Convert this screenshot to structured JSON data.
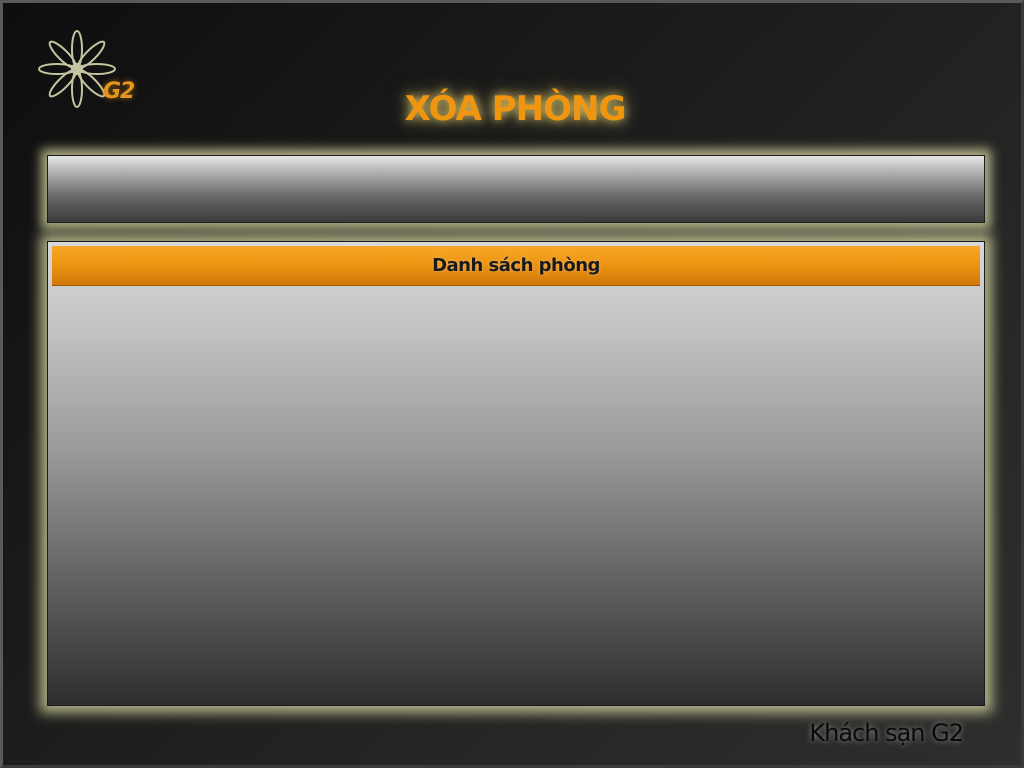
{
  "app": {
    "logo_text": "G2",
    "title": "XÓA PHÒNG",
    "footer": "Khách sạn G2"
  },
  "list": {
    "header": "Danh sách phòng",
    "items": []
  },
  "colors": {
    "accent": "#f0950f",
    "header_bar": "#ee9512",
    "glow": "#e1e1aa"
  },
  "icons": {
    "logo": "flower-logo-icon"
  }
}
